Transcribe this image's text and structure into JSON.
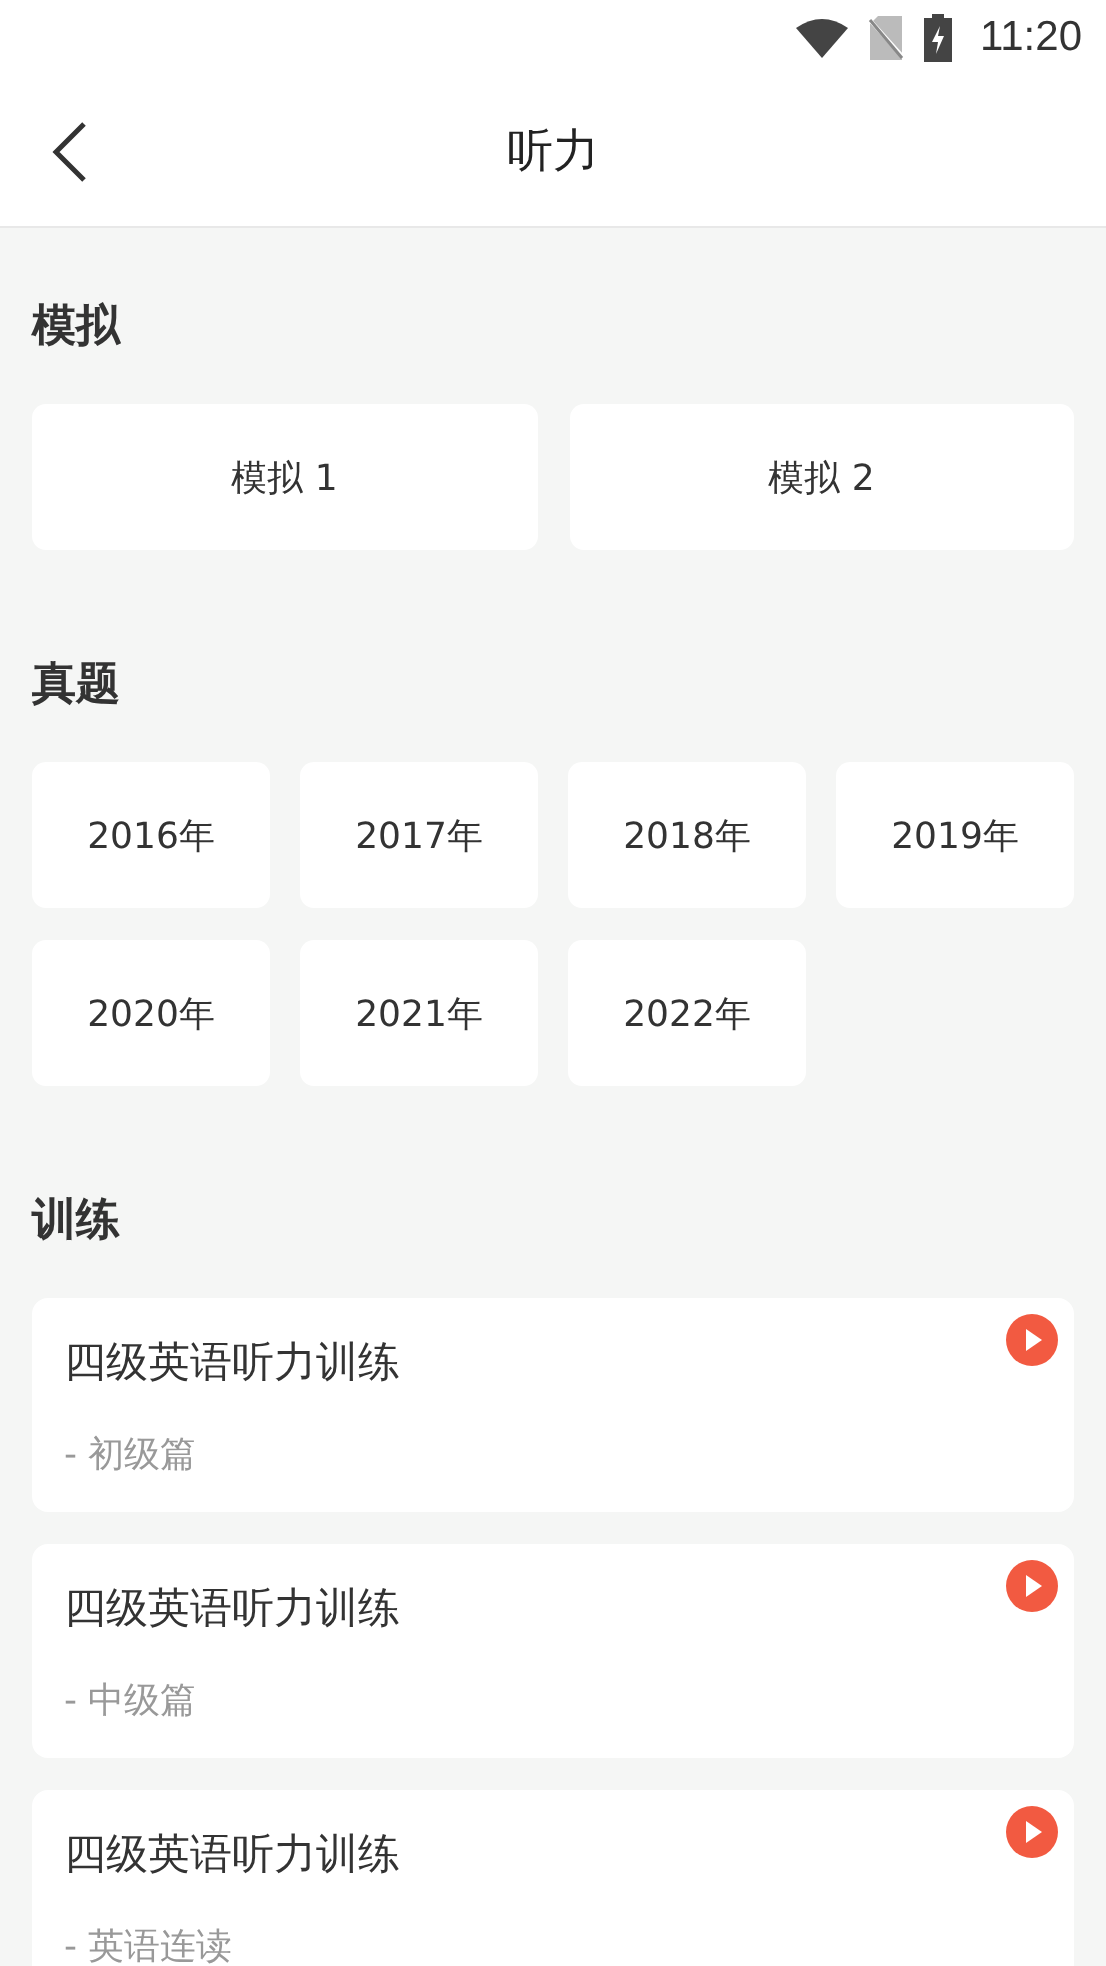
{
  "status_bar": {
    "time": "11:20"
  },
  "header": {
    "title": "听力"
  },
  "sections": [
    {
      "kind": "grid2",
      "title": "模拟",
      "items": [
        "模拟 1",
        "模拟 2"
      ]
    },
    {
      "kind": "grid4",
      "title": "真题",
      "items": [
        "2016年",
        "2017年",
        "2018年",
        "2019年",
        "2020年",
        "2021年",
        "2022年"
      ]
    },
    {
      "kind": "list",
      "title": "训练",
      "items": [
        {
          "title": "四级英语听力训练",
          "subtitle": "- 初级篇"
        },
        {
          "title": "四级英语听力训练",
          "subtitle": "- 中级篇"
        },
        {
          "title": "四级英语听力训练",
          "subtitle": "- 英语连读"
        }
      ]
    }
  ]
}
